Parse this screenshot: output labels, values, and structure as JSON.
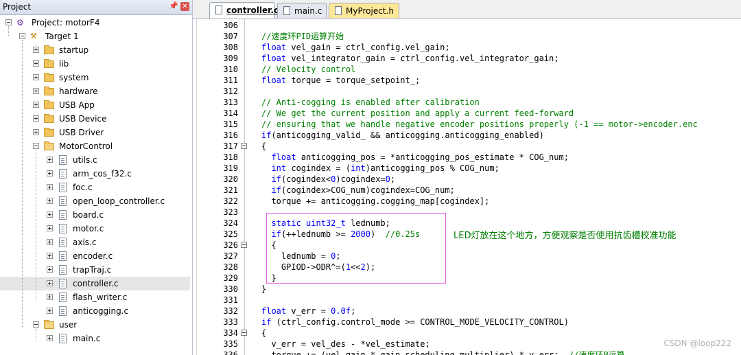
{
  "project_panel": {
    "title": "Project",
    "pin_icon": "pin-icon",
    "close_icon": "close-icon",
    "root": "Project: motorF4",
    "target": "Target 1",
    "groups": [
      "startup",
      "lib",
      "system",
      "hardware",
      "USB App",
      "USB Device",
      "USB Driver"
    ],
    "motorcontrol": "MotorControl",
    "motor_files": [
      "utils.c",
      "arm_cos_f32.c",
      "foc.c",
      "open_loop_controller.c",
      "board.c",
      "motor.c",
      "axis.c",
      "encoder.c",
      "trapTraj.c",
      "controller.c",
      "flash_writer.c",
      "anticogging.c"
    ],
    "selected_file": "controller.c",
    "user": "user",
    "user_files": [
      "main.c"
    ]
  },
  "tabs": [
    {
      "label": "controller.c",
      "active": true
    },
    {
      "label": "main.c",
      "active": false
    },
    {
      "label": "MyProject.h",
      "active": false
    }
  ],
  "editor": {
    "line_numbers": [
      "306",
      "307",
      "308",
      "309",
      "310",
      "311",
      "312",
      "313",
      "314",
      "315",
      "316",
      "317",
      "318",
      "319",
      "320",
      "321",
      "322",
      "323",
      "324",
      "325",
      "326",
      "327",
      "328",
      "329",
      "330",
      "331",
      "332",
      "333",
      "334",
      "335",
      "336"
    ],
    "lines": [
      "",
      "//速度环PID运算开始",
      "float vel_gain = ctrl_config.vel_gain;",
      "float vel_integrator_gain = ctrl_config.vel_integrator_gain;",
      "// Velocity control",
      "float torque = torque_setpoint_;",
      "",
      "// Anti-cogging is enabled after calibration",
      "// We get the current position and apply a current feed-forward",
      "// ensuring that we handle negative encoder positions properly (-1 == motor->encoder.enc",
      "if(anticogging_valid_ && anticogging.anticogging_enabled)",
      "{",
      "  float anticogging_pos = *anticogging_pos_estimate * COG_num;",
      "  int cogindex = (int)anticogging_pos % COG_num;",
      "  if(cogindex<0)cogindex=0;",
      "  if(cogindex>COG_num)cogindex=COG_num;",
      "  torque += anticogging.cogging_map[cogindex];",
      "",
      "  static uint32_t lednumb;",
      "  if(++lednumb >= 2000)  //0.25s",
      "  {",
      "    lednumb = 0;",
      "    GPIOD->ODR^=(1<<2);",
      "  }",
      "}",
      "",
      "float v_err = 0.0f;",
      "if (ctrl_config.control_mode >= CONTROL_MODE_VELOCITY_CONTROL)",
      "{",
      "  v_err = vel_des - *vel_estimate;",
      "  torque += (vel_gain * gain_scheduling_multiplier) * v_err;  //速度环P运算"
    ],
    "annotation": "LED灯放在这个地方，方便观察是否使用抗齿槽校准功能"
  },
  "watermark": "CSDN @loop222",
  "colors": {
    "keyword": "#0000ff",
    "comment": "#008000",
    "highlight_box": "#e060e0",
    "header_tab": "#ffe79a"
  }
}
